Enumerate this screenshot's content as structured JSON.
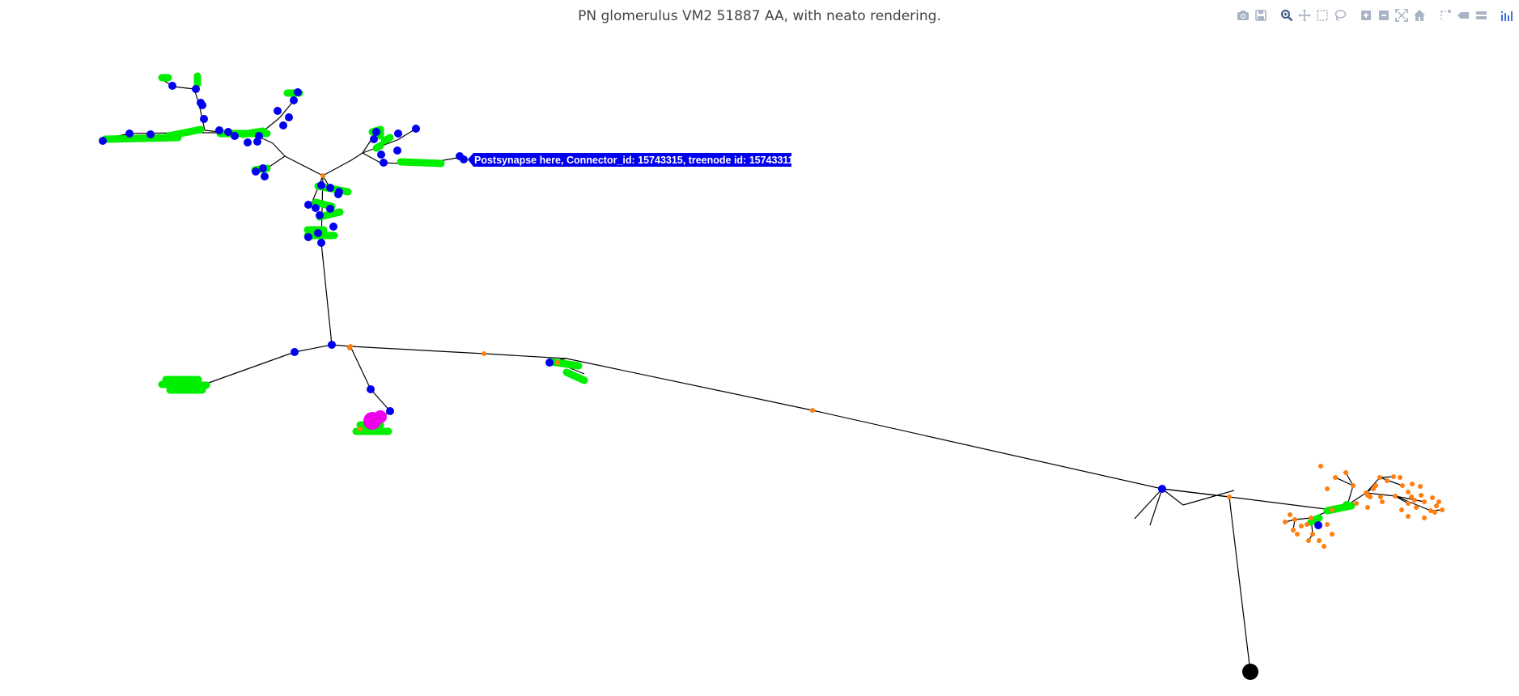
{
  "title": "PN glomerulus VM2 51887 AA, with neato rendering.",
  "hover": {
    "text": "Postsynapse here, Connector_id: 15743315, treenode id: 15743311",
    "bg_color": "#0000ee",
    "text_color": "#ffffff"
  },
  "colors": {
    "edge": "#000000",
    "postsynapse": "#0000ee",
    "presynapse": "#00ee00",
    "treenode": "#ff7f0e",
    "gap_junction": "#ee00ee",
    "soma": "#000000"
  },
  "modebar": {
    "icons": [
      {
        "name": "camera-icon",
        "tooltip": "Download plot as a png"
      },
      {
        "name": "save-icon",
        "tooltip": "Save and edit plot in cloud"
      },
      {
        "name": "zoom-icon",
        "tooltip": "Zoom"
      },
      {
        "name": "pan-icon",
        "tooltip": "Pan"
      },
      {
        "name": "box-select-icon",
        "tooltip": "Box Select"
      },
      {
        "name": "lasso-select-icon",
        "tooltip": "Lasso Select"
      },
      {
        "name": "zoom-in-icon",
        "tooltip": "Zoom in"
      },
      {
        "name": "zoom-out-icon",
        "tooltip": "Zoom out"
      },
      {
        "name": "autoscale-icon",
        "tooltip": "Autoscale"
      },
      {
        "name": "reset-axes-icon",
        "tooltip": "Reset axes"
      },
      {
        "name": "spike-lines-icon",
        "tooltip": "Toggle Spike Lines"
      },
      {
        "name": "hover-closest-icon",
        "tooltip": "Show closest data on hover"
      },
      {
        "name": "hover-compare-icon",
        "tooltip": "Compare data on hover"
      },
      {
        "name": "plotly-logo-icon",
        "tooltip": "Produced with Plotly"
      }
    ]
  }
}
